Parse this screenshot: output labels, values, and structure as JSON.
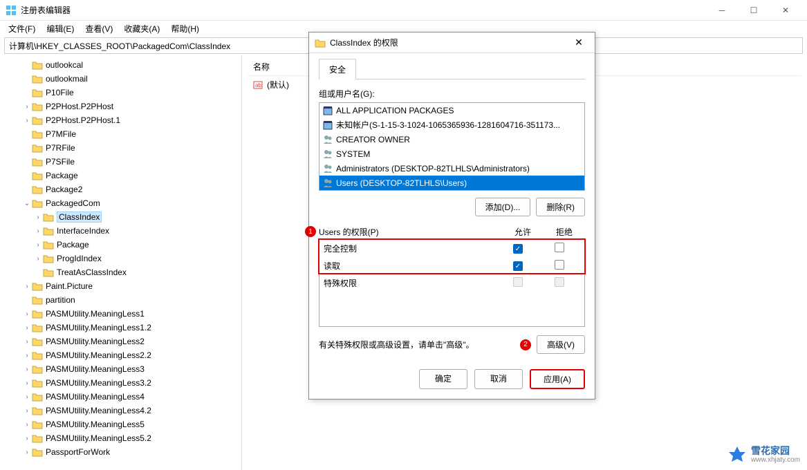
{
  "window": {
    "title": "注册表编辑器"
  },
  "menu": {
    "file": "文件(F)",
    "edit": "编辑(E)",
    "view": "查看(V)",
    "favorites": "收藏夹(A)",
    "help": "帮助(H)"
  },
  "address": "计算机\\HKEY_CLASSES_ROOT\\PackagedCom\\ClassIndex",
  "tree": [
    {
      "label": "outlookcal",
      "indent": 2,
      "toggle": ""
    },
    {
      "label": "outlookmail",
      "indent": 2,
      "toggle": ""
    },
    {
      "label": "P10File",
      "indent": 2,
      "toggle": ""
    },
    {
      "label": "P2PHost.P2PHost",
      "indent": 2,
      "toggle": ">"
    },
    {
      "label": "P2PHost.P2PHost.1",
      "indent": 2,
      "toggle": ">"
    },
    {
      "label": "P7MFile",
      "indent": 2,
      "toggle": ""
    },
    {
      "label": "P7RFile",
      "indent": 2,
      "toggle": ""
    },
    {
      "label": "P7SFile",
      "indent": 2,
      "toggle": ""
    },
    {
      "label": "Package",
      "indent": 2,
      "toggle": ""
    },
    {
      "label": "Package2",
      "indent": 2,
      "toggle": ""
    },
    {
      "label": "PackagedCom",
      "indent": 2,
      "toggle": "v"
    },
    {
      "label": "ClassIndex",
      "indent": 3,
      "toggle": ">",
      "selected": true
    },
    {
      "label": "InterfaceIndex",
      "indent": 3,
      "toggle": ">"
    },
    {
      "label": "Package",
      "indent": 3,
      "toggle": ">"
    },
    {
      "label": "ProgIdIndex",
      "indent": 3,
      "toggle": ">"
    },
    {
      "label": "TreatAsClassIndex",
      "indent": 3,
      "toggle": ""
    },
    {
      "label": "Paint.Picture",
      "indent": 2,
      "toggle": ">"
    },
    {
      "label": "partition",
      "indent": 2,
      "toggle": ""
    },
    {
      "label": "PASMUtility.MeaningLess1",
      "indent": 2,
      "toggle": ">"
    },
    {
      "label": "PASMUtility.MeaningLess1.2",
      "indent": 2,
      "toggle": ">"
    },
    {
      "label": "PASMUtility.MeaningLess2",
      "indent": 2,
      "toggle": ">"
    },
    {
      "label": "PASMUtility.MeaningLess2.2",
      "indent": 2,
      "toggle": ">"
    },
    {
      "label": "PASMUtility.MeaningLess3",
      "indent": 2,
      "toggle": ">"
    },
    {
      "label": "PASMUtility.MeaningLess3.2",
      "indent": 2,
      "toggle": ">"
    },
    {
      "label": "PASMUtility.MeaningLess4",
      "indent": 2,
      "toggle": ">"
    },
    {
      "label": "PASMUtility.MeaningLess4.2",
      "indent": 2,
      "toggle": ">"
    },
    {
      "label": "PASMUtility.MeaningLess5",
      "indent": 2,
      "toggle": ">"
    },
    {
      "label": "PASMUtility.MeaningLess5.2",
      "indent": 2,
      "toggle": ">"
    },
    {
      "label": "PassportForWork",
      "indent": 2,
      "toggle": ">"
    }
  ],
  "list": {
    "header_name": "名称",
    "default_value": "(默认)"
  },
  "dialog": {
    "title": "ClassIndex 的权限",
    "tab_security": "安全",
    "group_label": "组或用户名(G):",
    "principals": [
      {
        "name": "ALL APPLICATION PACKAGES",
        "icon": "package"
      },
      {
        "name": "未知帐户(S-1-15-3-1024-1065365936-1281604716-351173...",
        "icon": "package"
      },
      {
        "name": "CREATOR OWNER",
        "icon": "users"
      },
      {
        "name": "SYSTEM",
        "icon": "users"
      },
      {
        "name": "Administrators (DESKTOP-82TLHLS\\Administrators)",
        "icon": "users"
      },
      {
        "name": "Users (DESKTOP-82TLHLS\\Users)",
        "icon": "users",
        "selected": true
      }
    ],
    "add_btn": "添加(D)...",
    "remove_btn": "删除(R)",
    "perm_label": "Users 的权限(P)",
    "col_allow": "允许",
    "col_deny": "拒绝",
    "perms": [
      {
        "name": "完全控制",
        "allow": true,
        "deny": false
      },
      {
        "name": "读取",
        "allow": true,
        "deny": false
      },
      {
        "name": "特殊权限",
        "allow": false,
        "deny": false,
        "disabled": true
      }
    ],
    "advanced_text": "有关特殊权限或高级设置，请单击\"高级\"。",
    "advanced_btn": "高级(V)",
    "ok_btn": "确定",
    "cancel_btn": "取消",
    "apply_btn": "应用(A)",
    "badge1": "1",
    "badge2": "2"
  },
  "watermark": {
    "name": "雪花家园",
    "url": "www.xhjaty.com"
  }
}
